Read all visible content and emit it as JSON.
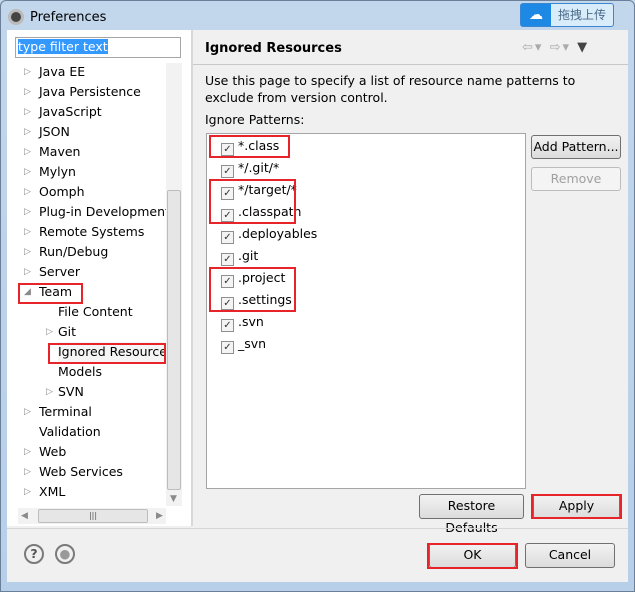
{
  "window": {
    "title": "Preferences",
    "upload_label": "拖拽上传"
  },
  "filter": {
    "value": "type filter text"
  },
  "tree": [
    {
      "label": "Java EE",
      "level": 0,
      "arrow": "collapsed"
    },
    {
      "label": "Java Persistence",
      "level": 0,
      "arrow": "collapsed"
    },
    {
      "label": "JavaScript",
      "level": 0,
      "arrow": "collapsed"
    },
    {
      "label": "JSON",
      "level": 0,
      "arrow": "collapsed"
    },
    {
      "label": "Maven",
      "level": 0,
      "arrow": "collapsed"
    },
    {
      "label": "Mylyn",
      "level": 0,
      "arrow": "collapsed"
    },
    {
      "label": "Oomph",
      "level": 0,
      "arrow": "collapsed"
    },
    {
      "label": "Plug-in Development",
      "level": 0,
      "arrow": "collapsed"
    },
    {
      "label": "Remote Systems",
      "level": 0,
      "arrow": "collapsed"
    },
    {
      "label": "Run/Debug",
      "level": 0,
      "arrow": "collapsed"
    },
    {
      "label": "Server",
      "level": 0,
      "arrow": "collapsed"
    },
    {
      "label": "Team",
      "level": 0,
      "arrow": "expanded"
    },
    {
      "label": "File Content",
      "level": 1,
      "arrow": "none"
    },
    {
      "label": "Git",
      "level": 1,
      "arrow": "collapsed"
    },
    {
      "label": "Ignored Resources",
      "level": 1,
      "arrow": "none",
      "selected": true
    },
    {
      "label": "Models",
      "level": 1,
      "arrow": "none"
    },
    {
      "label": "SVN",
      "level": 1,
      "arrow": "collapsed"
    },
    {
      "label": "Terminal",
      "level": 0,
      "arrow": "collapsed"
    },
    {
      "label": "Validation",
      "level": 0,
      "arrow": "none"
    },
    {
      "label": "Web",
      "level": 0,
      "arrow": "collapsed"
    },
    {
      "label": "Web Services",
      "level": 0,
      "arrow": "collapsed"
    },
    {
      "label": "XML",
      "level": 0,
      "arrow": "collapsed"
    }
  ],
  "page": {
    "title": "Ignored Resources",
    "description": "Use this page to specify a list of resource name patterns to exclude from version control.",
    "patterns_label": "Ignore Patterns:",
    "patterns": [
      {
        "label": "*.class",
        "checked": true
      },
      {
        "label": "*/.git/*",
        "checked": true
      },
      {
        "label": "*/target/*",
        "checked": true
      },
      {
        "label": ".classpath",
        "checked": true
      },
      {
        "label": ".deployables",
        "checked": true
      },
      {
        "label": ".git",
        "checked": true
      },
      {
        "label": ".project",
        "checked": true
      },
      {
        "label": ".settings",
        "checked": true
      },
      {
        "label": ".svn",
        "checked": true
      },
      {
        "label": "_svn",
        "checked": true
      }
    ],
    "add_pattern": "Add Pattern...",
    "remove": "Remove",
    "restore_defaults": "Restore Defaults",
    "apply": "Apply"
  },
  "footer": {
    "ok": "OK",
    "cancel": "Cancel"
  },
  "highlight_color": "#e8242b"
}
